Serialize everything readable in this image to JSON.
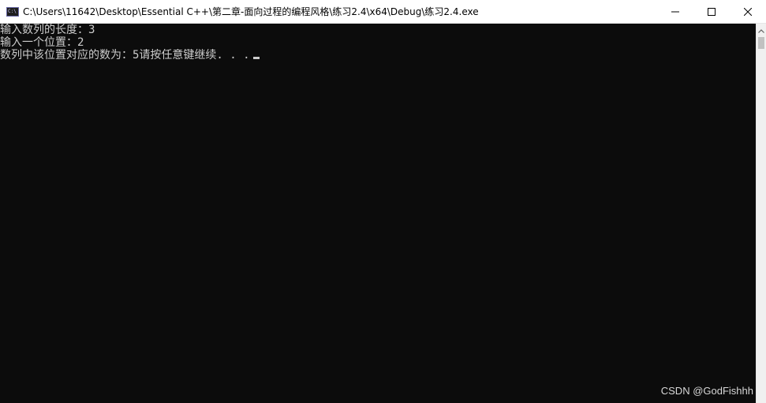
{
  "window": {
    "title": "C:\\Users\\11642\\Desktop\\Essential C++\\第二章-面向过程的编程风格\\练习2.4\\x64\\Debug\\练习2.4.exe",
    "app_icon_text": "C:\\"
  },
  "controls": [
    "minimize-icon",
    "maximize-icon",
    "close-icon"
  ],
  "console": {
    "lines": [
      "输入数列的长度：3",
      "输入一个位置：2",
      "数列中该位置对应的数为：5请按任意键继续. . ."
    ]
  },
  "watermark": "CSDN @GodFishhh",
  "colors": {
    "console_bg": "#0c0c0c",
    "console_fg": "#cccccc",
    "titlebar_bg": "#ffffff"
  }
}
